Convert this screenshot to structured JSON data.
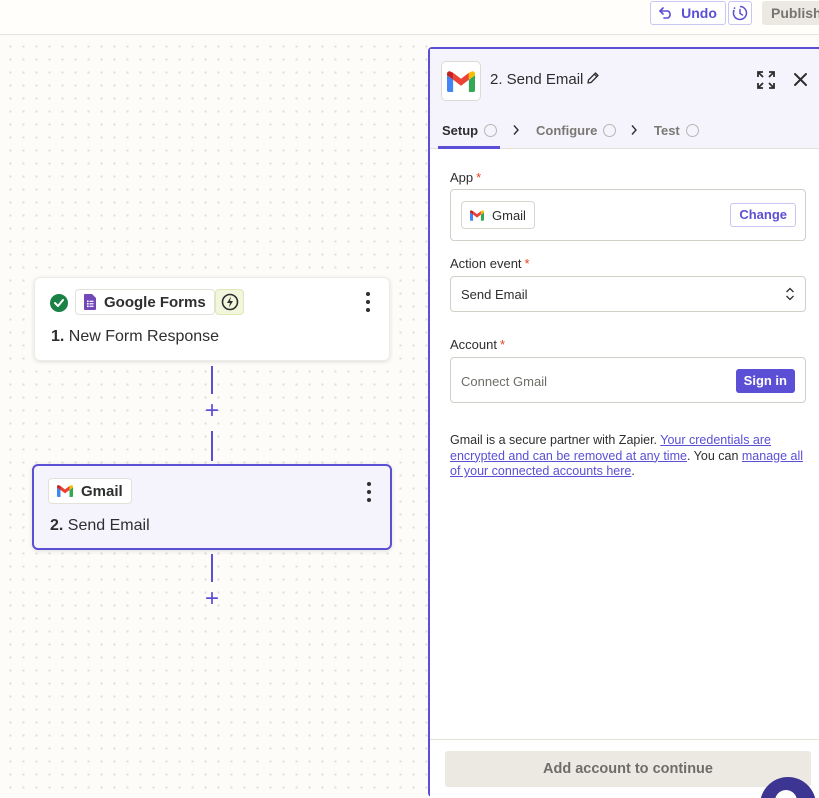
{
  "topbar": {
    "undo_label": "Undo",
    "publish_label": "Publish"
  },
  "canvas": {
    "trigger_step": {
      "app_name": "Google Forms",
      "number": "1.",
      "title": "New Form Response"
    },
    "action_step": {
      "app_name": "Gmail",
      "number": "2.",
      "title": "Send Email"
    },
    "add_step_symbol": "+"
  },
  "panel": {
    "title": "2. Send Email",
    "tabs": [
      {
        "label": "Setup"
      },
      {
        "label": "Configure"
      },
      {
        "label": "Test"
      }
    ],
    "app_field": {
      "label": "App",
      "required_mark": "*",
      "app_name": "Gmail",
      "change_label": "Change"
    },
    "action_event_field": {
      "label": "Action event",
      "required_mark": "*",
      "value": "Send Email"
    },
    "account_field": {
      "label": "Account",
      "required_mark": "*",
      "placeholder": "Connect Gmail",
      "signin_label": "Sign in"
    },
    "note": {
      "text_1": "Gmail is a secure partner with Zapier. ",
      "link_1": "Your credentials are encrypted and can be removed at any time",
      "text_2": ". You can ",
      "link_2": "manage all of your connected accounts here",
      "text_3": "."
    },
    "continue_label": "Add account to continue"
  },
  "colors": {
    "accent": "#5b4fd6",
    "success": "#1a8245",
    "required": "#e3431f"
  }
}
